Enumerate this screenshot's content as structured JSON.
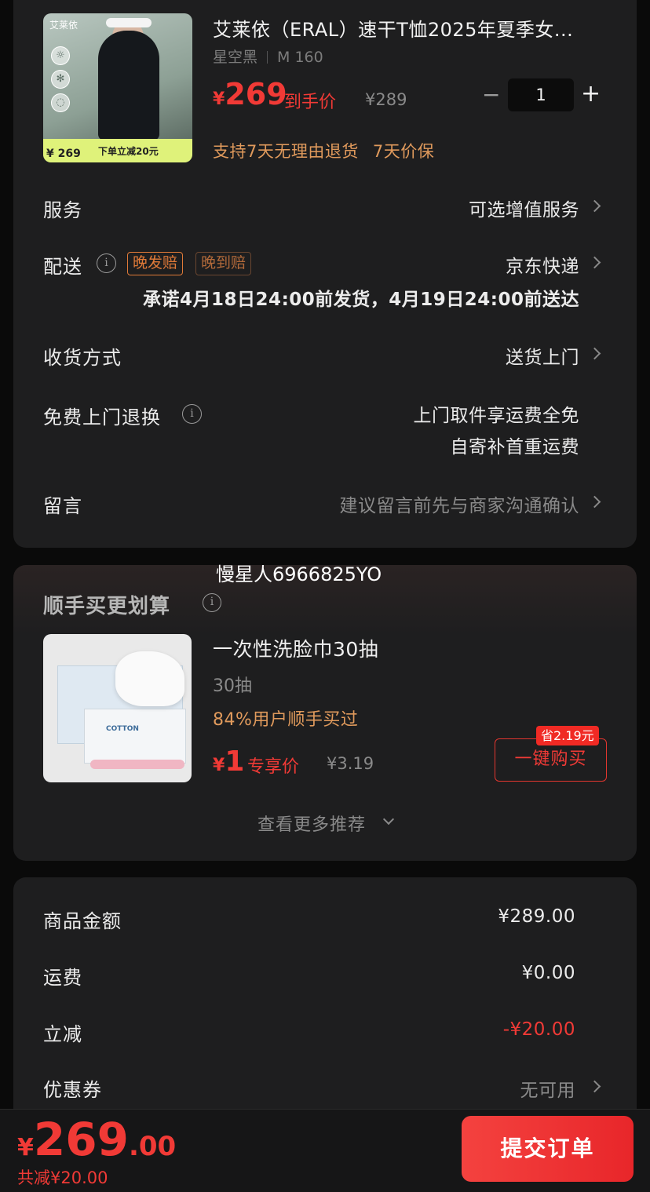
{
  "product": {
    "title": "艾莱依（ERAL）速干T恤2025年夏季女...",
    "color": "星空黑",
    "size": "M 160",
    "price_yen": "¥",
    "price": "269",
    "price_tag": "到手价",
    "original_price": "¥289",
    "quantity": "1",
    "minus_symbol": "−",
    "plus_symbol": "+",
    "guarantees": [
      "支持7天无理由退货",
      "7天价保"
    ],
    "thumb": {
      "brand": "艾莱依",
      "strip_price": "¥ 269",
      "strip_promo": "下单立减20元"
    }
  },
  "rows": {
    "service": {
      "label": "服务",
      "value": "可选增值服务"
    },
    "delivery": {
      "label": "配送",
      "badges": [
        "晚发赔",
        "晚到赔"
      ],
      "value": "京东快递",
      "promise": "承诺4月18日24:00前发货，4月19日24:00前送达"
    },
    "receive": {
      "label": "收货方式",
      "value": "送货上门"
    },
    "free_return": {
      "label": "免费上门退换",
      "value_line1": "上门取件享运费全免",
      "value_line2": "自寄补首重运费"
    },
    "message": {
      "label": "留言",
      "placeholder": "建议留言前先与商家沟通确认"
    }
  },
  "overlay_user": "慢星人6966825YO",
  "addon": {
    "section_title": "顺手买更划算",
    "title": "一次性洗脸巾30抽",
    "spec": "30抽",
    "buyers": "84%用户顺手买过",
    "price_yen": "¥",
    "price": "1",
    "price_tag": "专享价",
    "original_price": "¥3.19",
    "save_badge": "省2.19元",
    "buy_button": "一键购买",
    "cotton_label": "COTTON",
    "more": "查看更多推荐"
  },
  "summary": {
    "goods_amount": {
      "label": "商品金额",
      "value": "¥289.00"
    },
    "shipping": {
      "label": "运费",
      "value": "¥0.00"
    },
    "discount": {
      "label": "立减",
      "value": "-¥20.00"
    },
    "coupon": {
      "label": "优惠券",
      "value": "无可用"
    }
  },
  "bottom": {
    "total_yen": "¥",
    "total_int": "269",
    "total_dec": ".00",
    "saved": "共减¥20.00",
    "submit": "提交订单"
  },
  "colors": {
    "accent_red": "#f13a36",
    "orange": "#e09a5c",
    "card_bg": "#1e1e1f",
    "page_bg": "#0a0a0a"
  },
  "icons": [
    "info-icon",
    "chevron-right-icon",
    "chevron-down-icon",
    "minus-icon",
    "plus-icon"
  ]
}
